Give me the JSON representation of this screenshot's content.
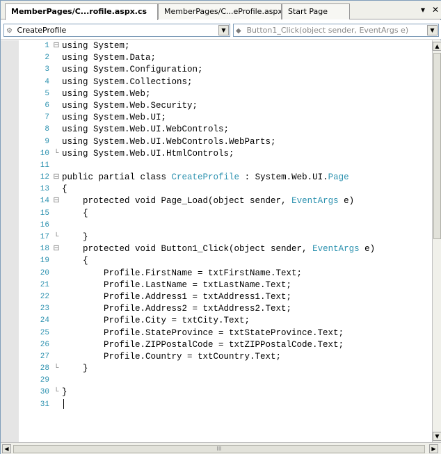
{
  "tabs": [
    {
      "label": "MemberPages/C...rofile.aspx.cs",
      "active": true
    },
    {
      "label": "MemberPages/C...eProfile.aspx",
      "active": false
    },
    {
      "label": "Start Page",
      "active": false
    }
  ],
  "tabbar": {
    "dropdown_glyph": "▾",
    "close_glyph": "✕"
  },
  "navbar": {
    "class_combo": {
      "value": "CreateProfile",
      "icon": "class-icon"
    },
    "member_combo": {
      "value": "Button1_Click(object sender, EventArgs e)",
      "icon": "method-icon"
    }
  },
  "code": {
    "lines": [
      {
        "num": "1",
        "fold": "⊟",
        "text": "using System;"
      },
      {
        "num": "2",
        "fold": "",
        "text": "using System.Data;"
      },
      {
        "num": "3",
        "fold": "",
        "text": "using System.Configuration;"
      },
      {
        "num": "4",
        "fold": "",
        "text": "using System.Collections;"
      },
      {
        "num": "5",
        "fold": "",
        "text": "using System.Web;"
      },
      {
        "num": "6",
        "fold": "",
        "text": "using System.Web.Security;"
      },
      {
        "num": "7",
        "fold": "",
        "text": "using System.Web.UI;"
      },
      {
        "num": "8",
        "fold": "",
        "text": "using System.Web.UI.WebControls;"
      },
      {
        "num": "9",
        "fold": "",
        "text": "using System.Web.UI.WebControls.WebParts;"
      },
      {
        "num": "10",
        "fold": "└",
        "text": "using System.Web.UI.HtmlControls;"
      },
      {
        "num": "11",
        "fold": "",
        "text": ""
      },
      {
        "num": "12",
        "fold": "⊟",
        "pre": "public partial class ",
        "type1": "CreateProfile",
        "mid": " : System.Web.UI.",
        "type2": "Page",
        "post": ""
      },
      {
        "num": "13",
        "fold": "",
        "text": "{"
      },
      {
        "num": "14",
        "fold": "⊟",
        "pre": "    protected void Page_Load(object sender, ",
        "type1": "EventArgs",
        "mid": " e)",
        "type2": "",
        "post": ""
      },
      {
        "num": "15",
        "fold": "",
        "text": "    {"
      },
      {
        "num": "16",
        "fold": "",
        "text": ""
      },
      {
        "num": "17",
        "fold": "└",
        "text": "    }"
      },
      {
        "num": "18",
        "fold": "⊟",
        "pre": "    protected void Button1_Click(object sender, ",
        "type1": "EventArgs",
        "mid": " e)",
        "type2": "",
        "post": ""
      },
      {
        "num": "19",
        "fold": "",
        "text": "    {"
      },
      {
        "num": "20",
        "fold": "",
        "text": "        Profile.FirstName = txtFirstName.Text;"
      },
      {
        "num": "21",
        "fold": "",
        "text": "        Profile.LastName = txtLastName.Text;"
      },
      {
        "num": "22",
        "fold": "",
        "text": "        Profile.Address1 = txtAddress1.Text;"
      },
      {
        "num": "23",
        "fold": "",
        "text": "        Profile.Address2 = txtAddress2.Text;"
      },
      {
        "num": "24",
        "fold": "",
        "text": "        Profile.City = txtCity.Text;"
      },
      {
        "num": "25",
        "fold": "",
        "text": "        Profile.StateProvince = txtStateProvince.Text;"
      },
      {
        "num": "26",
        "fold": "",
        "text": "        Profile.ZIPPostalCode = txtZIPPostalCode.Text;"
      },
      {
        "num": "27",
        "fold": "",
        "text": "        Profile.Country = txtCountry.Text;"
      },
      {
        "num": "28",
        "fold": "└",
        "text": "    }"
      },
      {
        "num": "29",
        "fold": "",
        "text": ""
      },
      {
        "num": "30",
        "fold": "└",
        "text": "}"
      },
      {
        "num": "31",
        "fold": "",
        "text": "",
        "cursor": true
      }
    ]
  },
  "scrollbars": {
    "up_glyph": "▲",
    "down_glyph": "▼",
    "left_glyph": "◀",
    "right_glyph": "▶",
    "grip": "III"
  },
  "colors": {
    "type_name": "#2b91af",
    "line_number": "#2b91af",
    "gutter": "#e5e5e5"
  }
}
